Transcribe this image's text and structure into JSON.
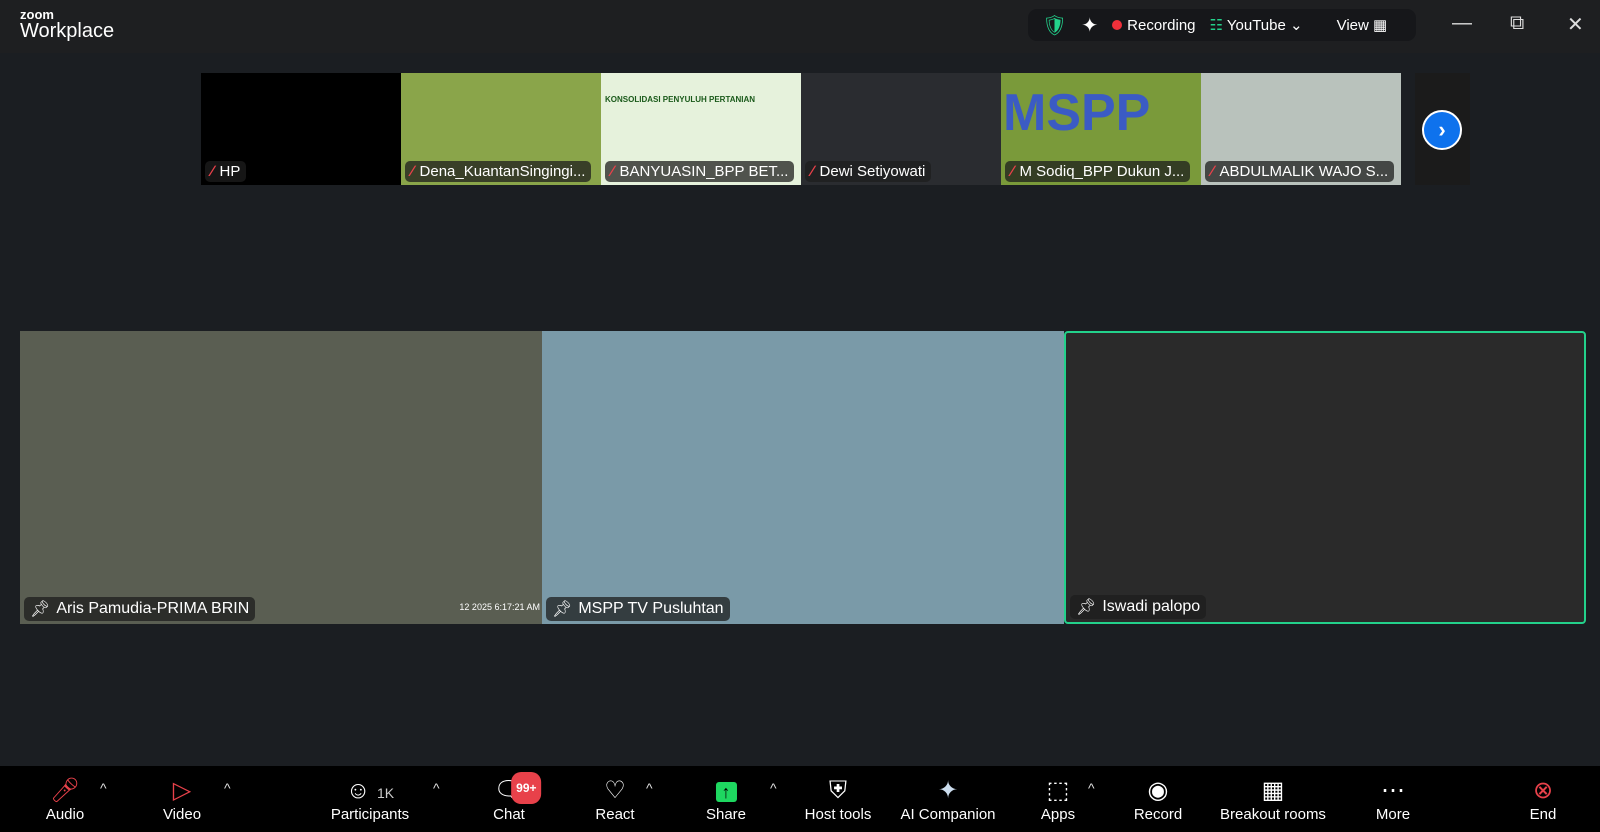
{
  "app": {
    "brand_top": "zoom",
    "brand_bottom": "Workplace"
  },
  "topbar": {
    "recording": "Recording",
    "stream": "YouTube",
    "view": "View"
  },
  "thumbnails": [
    {
      "name": "HP",
      "bg": "#000000"
    },
    {
      "name": "Dena_KuantanSingingi...",
      "bg": "#8aa54a"
    },
    {
      "name": "BANYUASIN_BPP BET...",
      "bg": "#e6f2dc",
      "slide_title": "KONSOLIDASI PENYULUH PERTANIAN"
    },
    {
      "name": "Dewi Setiyowati",
      "bg": "#2a2c30"
    },
    {
      "name": "M Sodiq_BPP Dukun J...",
      "bg": "#7a9a3a",
      "backdrop_text": "MSPP"
    },
    {
      "name": "ABDULMALIK WAJO S...",
      "bg": "#b9c2bc"
    }
  ],
  "tiles": [
    {
      "name": "Aris Pamudia-PRIMA BRIN",
      "bg": "#5a5e52",
      "timestamp": "12 2025 6:17:21 AM"
    },
    {
      "name": "MSPP TV Pusluhtan",
      "bg": "#7a9aa8"
    },
    {
      "name": "Iswadi palopo",
      "bg": "#2a2a2a",
      "active_speaker": true
    }
  ],
  "toolbar": {
    "audio": "Audio",
    "video": "Video",
    "participants": "Participants",
    "participants_count": "1K",
    "chat": "Chat",
    "chat_badge": "99+",
    "react": "React",
    "share": "Share",
    "host_tools": "Host tools",
    "ai_companion": "AI Companion",
    "apps": "Apps",
    "record": "Record",
    "breakout": "Breakout rooms",
    "more": "More",
    "end": "End"
  },
  "colors": {
    "accent": "#0e72ed",
    "active": "#23d18b",
    "muted": "#e8414a",
    "share": "#1ed760"
  }
}
